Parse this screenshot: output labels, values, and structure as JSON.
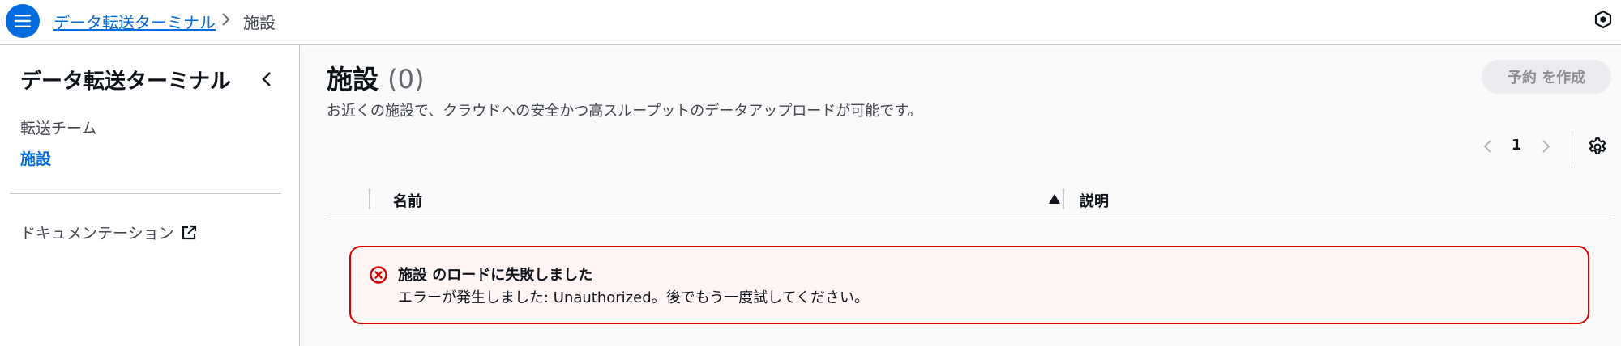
{
  "header": {
    "breadcrumb_link": "データ転送ターミナル",
    "breadcrumb_current": "施設"
  },
  "sidebar": {
    "title": "データ転送ターミナル",
    "items": [
      {
        "label": "転送チーム"
      },
      {
        "label": "施設"
      }
    ],
    "documentation": "ドキュメンテーション"
  },
  "main": {
    "title": "施設",
    "count": "(0)",
    "description": "お近くの施設で、クラウドへの安全かつ高スループットのデータアップロードが可能です。",
    "create_button": "予約 を作成",
    "pagination": {
      "current_page": "1"
    },
    "table": {
      "columns": [
        {
          "label": "名前"
        },
        {
          "label": "説明"
        }
      ]
    },
    "alert": {
      "title": "施設 のロードに失敗しました",
      "message": "エラーが発生しました: Unauthorized。後でもう一度試してください。"
    }
  },
  "colors": {
    "accent": "#006ce0",
    "error": "#db0000",
    "error_bg": "#fff5f5"
  },
  "icons": [
    "menu-icon",
    "chevron-right-icon",
    "hexagon-logo-icon",
    "chevron-left-icon",
    "external-link-icon",
    "gear-icon",
    "sort-ascending-icon",
    "error-icon"
  ]
}
